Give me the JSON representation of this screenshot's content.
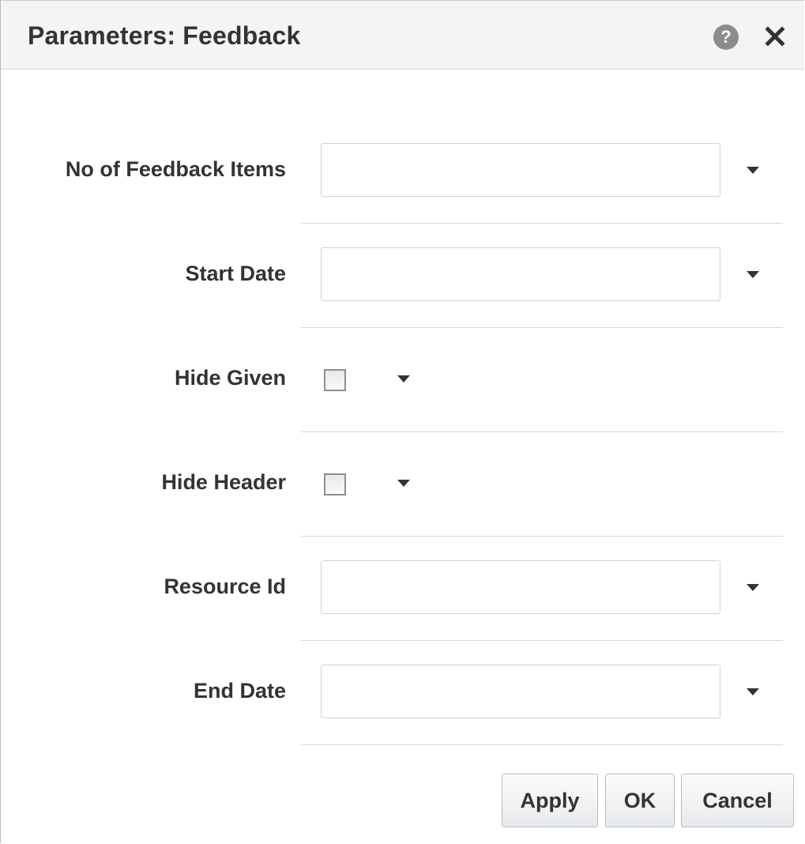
{
  "dialog": {
    "title": "Parameters: Feedback",
    "help_label": "?"
  },
  "parameters": [
    {
      "label": "No of Feedback Items",
      "type": "text",
      "value": ""
    },
    {
      "label": "Start Date",
      "type": "text",
      "value": ""
    },
    {
      "label": "Hide Given",
      "type": "checkbox",
      "checked": false
    },
    {
      "label": "Hide Header",
      "type": "checkbox",
      "checked": false
    },
    {
      "label": "Resource Id",
      "type": "text",
      "value": ""
    },
    {
      "label": "End Date",
      "type": "text",
      "value": ""
    }
  ],
  "buttons": {
    "apply": "Apply",
    "ok": "OK",
    "cancel": "Cancel"
  },
  "icons": {
    "help": "help-icon",
    "close": "close-icon",
    "dropdown": "caret-down-icon"
  },
  "colors": {
    "title_bar": "#f4f4f4",
    "text": "#333333",
    "border": "#d2d2d2",
    "help_icon": "#8c8c8c"
  }
}
